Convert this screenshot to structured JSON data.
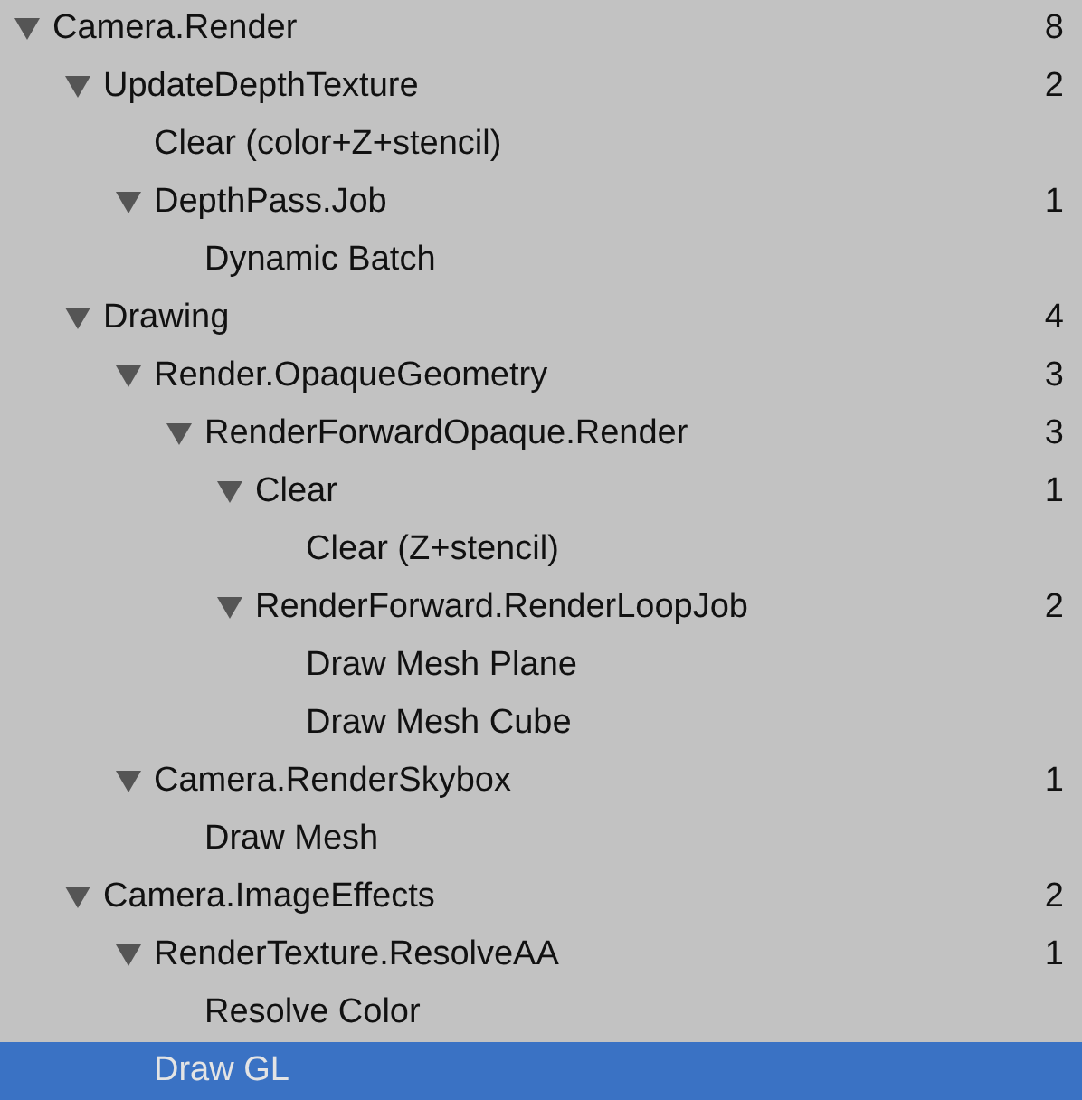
{
  "tree": [
    {
      "label": "Camera.Render",
      "count": "8",
      "expanded": true,
      "selected": false,
      "children": [
        {
          "label": "UpdateDepthTexture",
          "count": "2",
          "expanded": true,
          "selected": false,
          "children": [
            {
              "label": "Clear (color+Z+stencil)",
              "selected": false
            },
            {
              "label": "DepthPass.Job",
              "count": "1",
              "expanded": true,
              "selected": false,
              "children": [
                {
                  "label": "Dynamic Batch",
                  "selected": false
                }
              ]
            }
          ]
        },
        {
          "label": "Drawing",
          "count": "4",
          "expanded": true,
          "selected": false,
          "children": [
            {
              "label": "Render.OpaqueGeometry",
              "count": "3",
              "expanded": true,
              "selected": false,
              "children": [
                {
                  "label": "RenderForwardOpaque.Render",
                  "count": "3",
                  "expanded": true,
                  "selected": false,
                  "children": [
                    {
                      "label": "Clear",
                      "count": "1",
                      "expanded": true,
                      "selected": false,
                      "children": [
                        {
                          "label": "Clear (Z+stencil)",
                          "selected": false
                        }
                      ]
                    },
                    {
                      "label": "RenderForward.RenderLoopJob",
                      "count": "2",
                      "expanded": true,
                      "selected": false,
                      "children": [
                        {
                          "label": "Draw Mesh Plane",
                          "selected": false
                        },
                        {
                          "label": "Draw Mesh Cube",
                          "selected": false
                        }
                      ]
                    }
                  ]
                }
              ]
            },
            {
              "label": "Camera.RenderSkybox",
              "count": "1",
              "expanded": true,
              "selected": false,
              "children": [
                {
                  "label": "Draw Mesh",
                  "selected": false
                }
              ]
            }
          ]
        },
        {
          "label": "Camera.ImageEffects",
          "count": "2",
          "expanded": true,
          "selected": false,
          "children": [
            {
              "label": "RenderTexture.ResolveAA",
              "count": "1",
              "expanded": true,
              "selected": false,
              "children": [
                {
                  "label": "Resolve Color",
                  "selected": false
                }
              ]
            },
            {
              "label": "Draw GL",
              "selected": true
            }
          ]
        }
      ]
    }
  ]
}
